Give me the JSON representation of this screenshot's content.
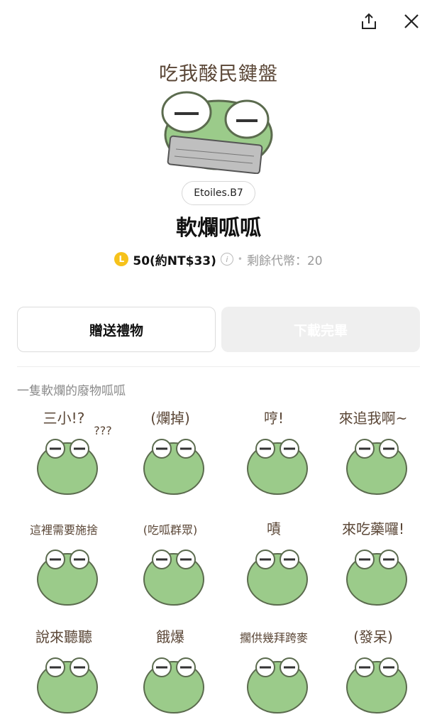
{
  "topbar": {
    "share_icon": "share-icon",
    "close_icon": "close-icon"
  },
  "hero": {
    "caption": "吃我酸民鍵盤"
  },
  "author": "Etoiles.B7",
  "title": "軟爛呱呱",
  "price": {
    "coin_symbol": "L",
    "amount": "50(約NT$33)",
    "info_symbol": "i",
    "remaining": "剩餘代幣：20"
  },
  "buttons": {
    "gift": "贈送禮物",
    "download": "下載完畢"
  },
  "description": "一隻軟爛的廢物呱呱",
  "stickers": [
    {
      "text": "三小!?",
      "extra": "???"
    },
    {
      "text": "(爛掉)"
    },
    {
      "text": "哼!"
    },
    {
      "text": "來追我啊~"
    },
    {
      "text": "這裡需要施捨"
    },
    {
      "text": "(吃呱群眾)"
    },
    {
      "text": "嘖"
    },
    {
      "text": "來吃藥囉!"
    },
    {
      "text": "說來聽聽"
    },
    {
      "text": "餓爆"
    },
    {
      "text": "擱供幾拜跨麥"
    },
    {
      "text": "(發呆)"
    }
  ],
  "colors": {
    "frog": "#9bcb8a",
    "frog_outline": "#5b6b4e",
    "text_brown": "#5a4636",
    "coin": "#f6c21b"
  }
}
